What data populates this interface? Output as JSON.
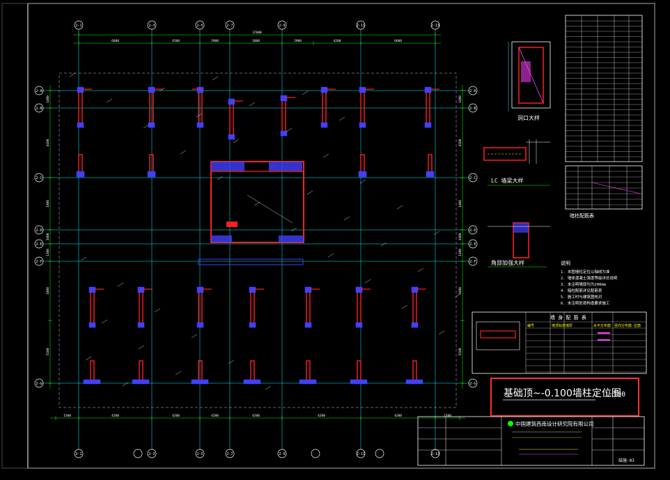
{
  "drawing": {
    "title": "基础顶~-0.100墙柱定位图",
    "scale": "1:100",
    "company": "中国建筑西南设计研究院有限公司",
    "sheet_no": "结施-03"
  },
  "grids": {
    "top_labels": [
      "2-1",
      "2-3",
      "2-5",
      "2-7",
      "2-9",
      "2-11",
      "2-13",
      "2-15"
    ],
    "bottom_labels": [
      "2-1",
      "2-3",
      "2-5",
      "2-7",
      "2-9",
      "2-11",
      "2-13",
      "2-15"
    ],
    "left_labels": [
      "2-A",
      "2-B",
      "2-C",
      "2-D",
      "2-E",
      "2-F",
      "2-G"
    ],
    "right_labels": [
      "2-A",
      "2-B",
      "2-C",
      "2-D",
      "2-E",
      "2-F",
      "2-G"
    ]
  },
  "dimensions": {
    "top_total": "37800",
    "top_segments": [
      "6600",
      "4200",
      "2900",
      "1800",
      "2900",
      "4200",
      "6600"
    ],
    "bottom_segments": [
      "1500",
      "4200",
      "4200",
      "4200",
      "4200",
      "4200",
      "4200",
      "1500"
    ],
    "left_segments": [
      "1400",
      "4100",
      "1400",
      "3400",
      "1300",
      "3400",
      "5100"
    ]
  },
  "details": {
    "opening_detail_title": "洞口大样",
    "lc_detail_title": "LC 墙梁大样",
    "corner_detail_title": "角部加强大样",
    "table_title": "暗柱配筋表",
    "notes_heading": "说明",
    "notes": [
      "1. 本图墙柱定位以轴线为准",
      "2. 墙体混凝土强度等级详总说明",
      "3. 未注明墙厚均为200mm",
      "4. 暗柱配筋详见配筋表",
      "5. 施工时与建筑图核对",
      "6. 未注明处按构造要求施工"
    ],
    "legend_title": "墙 身 配 筋 表",
    "legend_headers": [
      "编号",
      "墙顶标高",
      "墙厚",
      "水平分布筋",
      "竖向分布筋",
      "拉筋"
    ]
  },
  "colors": {
    "background": "#000000",
    "axis": "#00ffff",
    "wall": "#ff2020",
    "column": "#4040ff",
    "text": "#ffffff",
    "dim": "#00ff00",
    "highlight": "#ff3030",
    "yellow": "#ffff00",
    "magenta": "#ff40ff"
  }
}
